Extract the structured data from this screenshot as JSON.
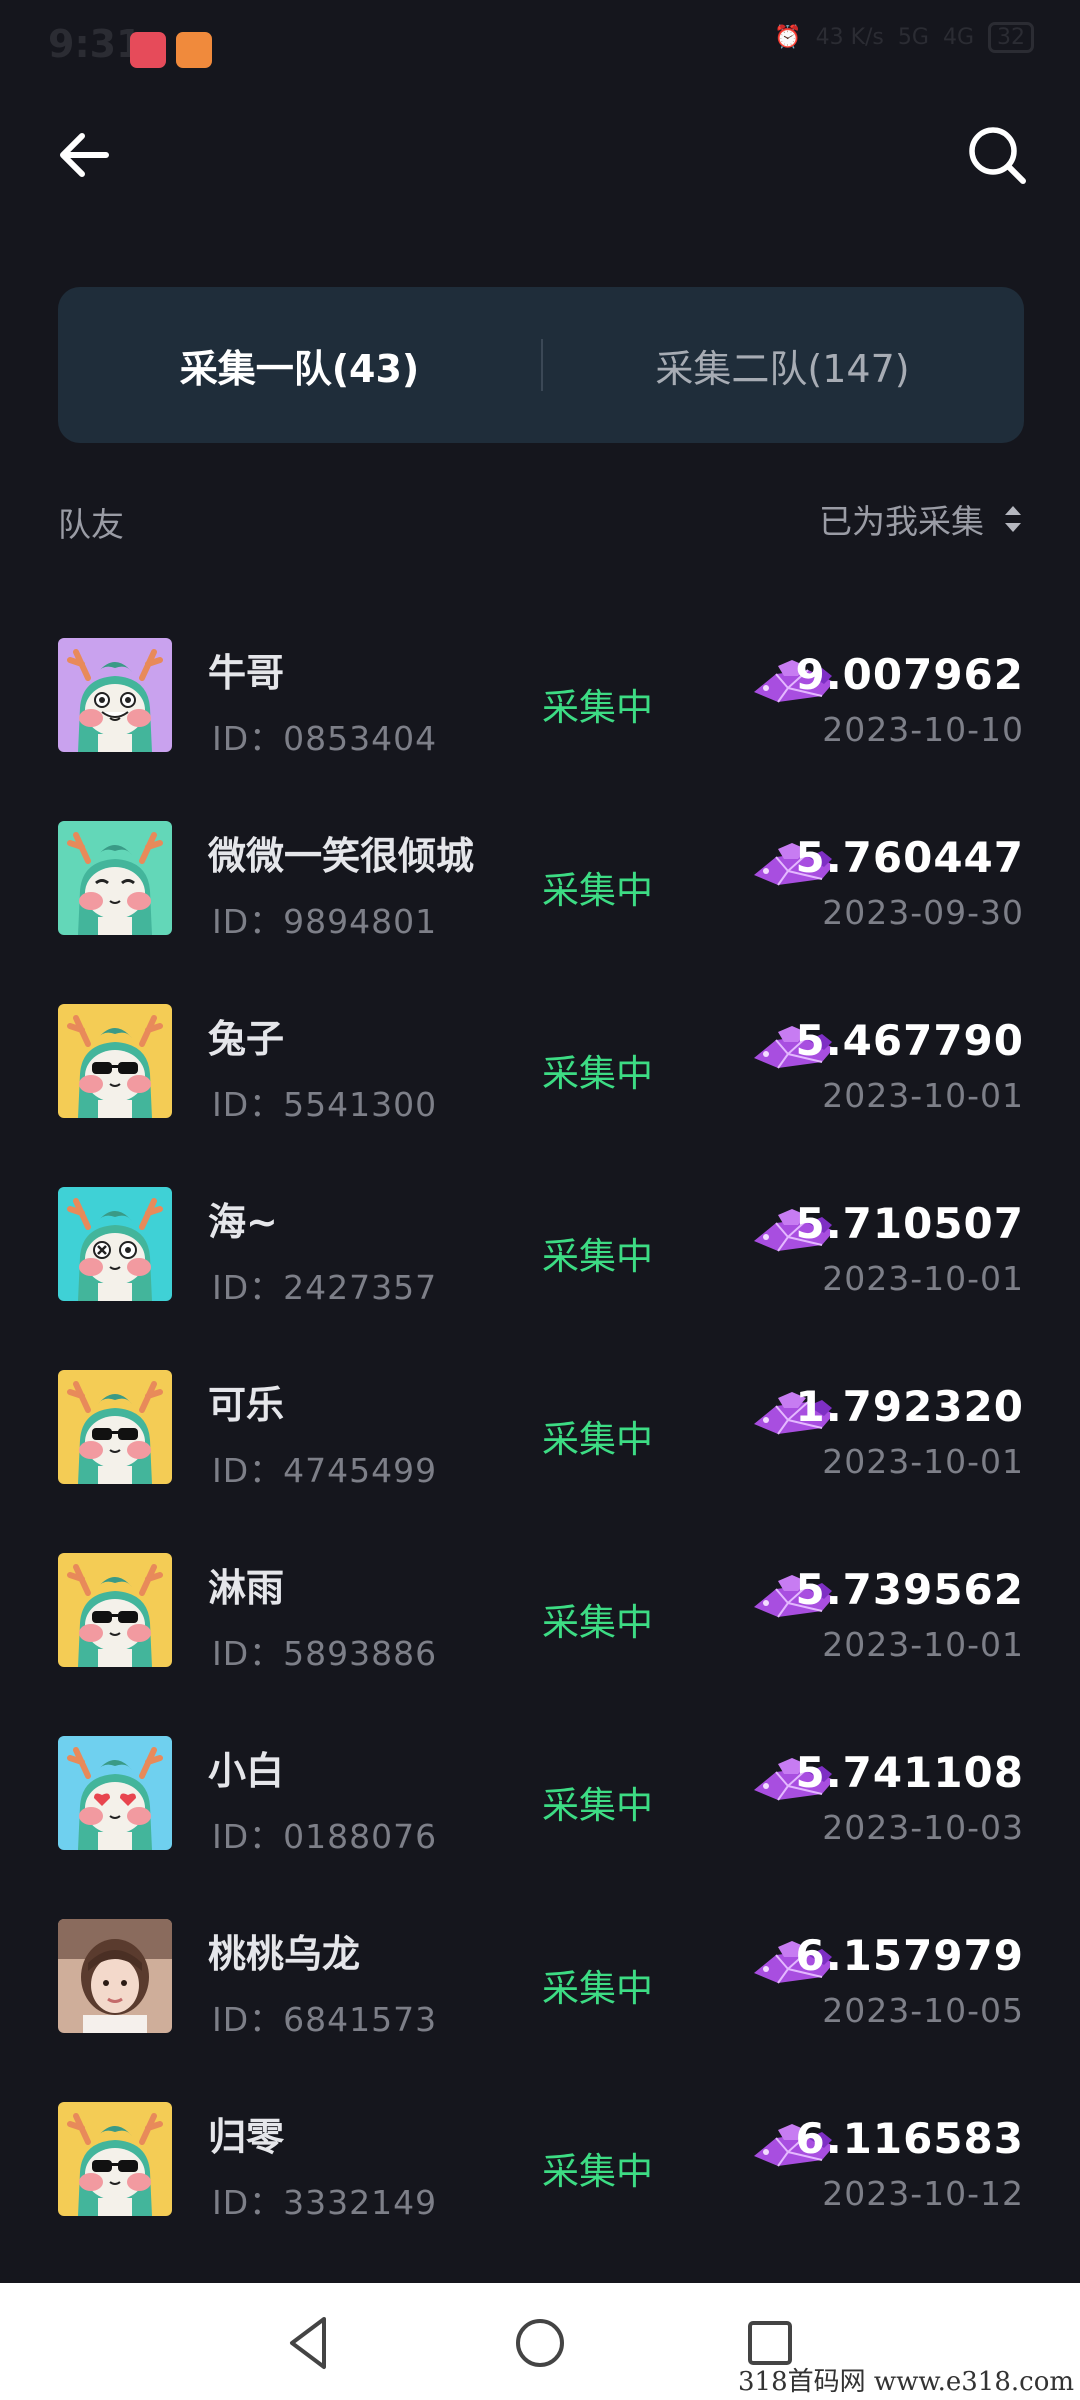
{
  "status_bar": {
    "time": "9:31",
    "network_speed": "43 K/s",
    "signal_1": "5G",
    "signal_2": "4G",
    "battery": "32"
  },
  "tabs": [
    {
      "label": "采集一队(43)",
      "active": true
    },
    {
      "label": "采集二队(147)",
      "active": false
    }
  ],
  "list_header": {
    "left_label": "队友",
    "sort_label": "已为我采集"
  },
  "members": [
    {
      "name": "牛哥",
      "id": "ID：0853404",
      "status": "采集中",
      "amount": "9.007962",
      "date": "2023-10-10",
      "avatar_bg": "#c9a2ee",
      "avatar_face": "grin"
    },
    {
      "name": "微微一笑很倾城",
      "id": "ID：9894801",
      "status": "采集中",
      "amount": "5.760447",
      "date": "2023-09-30",
      "avatar_bg": "#63d7b8",
      "avatar_face": "calm"
    },
    {
      "name": "兔子",
      "id": "ID：5541300",
      "status": "采集中",
      "amount": "5.467790",
      "date": "2023-10-01",
      "avatar_bg": "#f4cc55",
      "avatar_face": "shades"
    },
    {
      "name": "海~",
      "id": "ID：2427357",
      "status": "采集中",
      "amount": "5.710507",
      "date": "2023-10-01",
      "avatar_bg": "#3fd1d6",
      "avatar_face": "dizzy"
    },
    {
      "name": "可乐",
      "id": "ID：4745499",
      "status": "采集中",
      "amount": "1.792320",
      "date": "2023-10-01",
      "avatar_bg": "#f4cc55",
      "avatar_face": "shades"
    },
    {
      "name": "淋雨",
      "id": "ID：5893886",
      "status": "采集中",
      "amount": "5.739562",
      "date": "2023-10-01",
      "avatar_bg": "#f4cc55",
      "avatar_face": "shades"
    },
    {
      "name": "小白",
      "id": "ID：0188076",
      "status": "采集中",
      "amount": "5.741108",
      "date": "2023-10-03",
      "avatar_bg": "#6fd0ef",
      "avatar_face": "hearts"
    },
    {
      "name": "桃桃乌龙",
      "id": "ID：6841573",
      "status": "采集中",
      "amount": "6.157979",
      "date": "2023-10-05",
      "avatar_bg": "#d8b9a6",
      "avatar_face": "photo"
    },
    {
      "name": "归零",
      "id": "ID：3332149",
      "status": "采集中",
      "amount": "6.116583",
      "date": "2023-10-12",
      "avatar_bg": "#f4cc55",
      "avatar_face": "shades"
    }
  ],
  "colors": {
    "background": "#15161d",
    "tab_bg": "#1f2d3a",
    "status_green": "#3ddc84",
    "gem_purple": "#a84ee0"
  },
  "watermark": "318首码网  www.e318.com"
}
